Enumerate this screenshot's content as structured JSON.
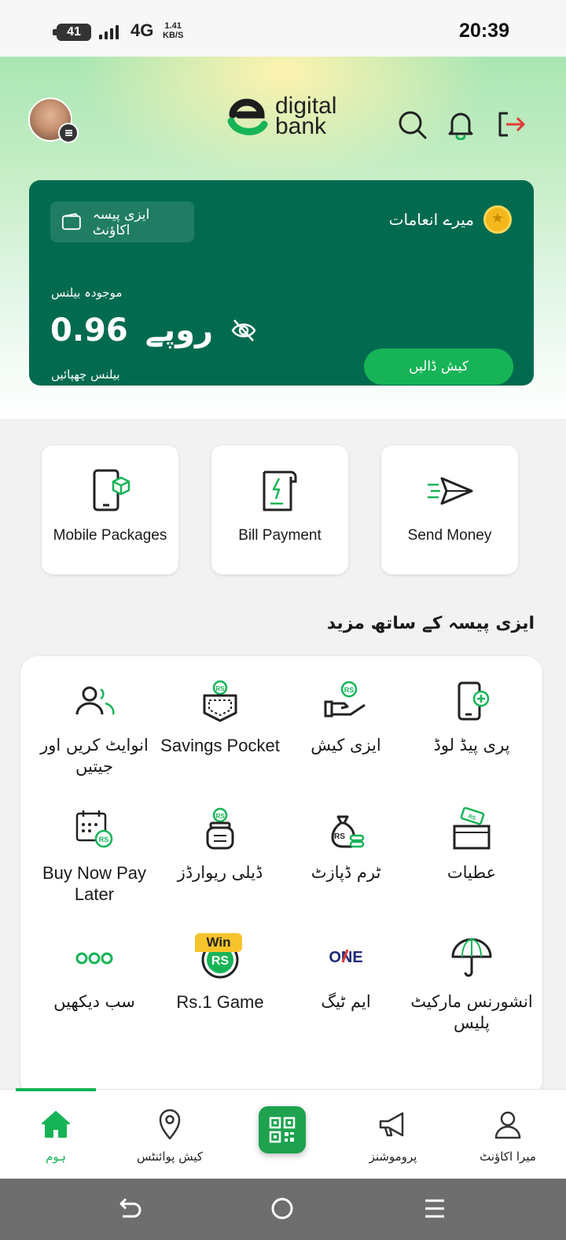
{
  "status_bar": {
    "battery": "41",
    "network": "4G",
    "speed_value": "1.41",
    "speed_unit": "KB/S",
    "time": "20:39"
  },
  "header": {
    "logo_line1": "digital",
    "logo_line2": "bank",
    "icons": [
      "search-icon",
      "bell-icon",
      "logout-icon"
    ]
  },
  "balance_card": {
    "wallet_label": "ایزی پیسہ اکاؤنٹ",
    "rewards_label": "میرے انعامات",
    "balance_label": "موجودہ بیلنس",
    "currency": "روپے",
    "amount": "0.96",
    "hide_label": "بیلنس چھپائیں",
    "cash_button": "کیش ڈالیں"
  },
  "quick_actions": [
    {
      "label": "Mobile Packages",
      "icon": "mobile-package-icon"
    },
    {
      "label": "Bill Payment",
      "icon": "bill-icon"
    },
    {
      "label": "Send Money",
      "icon": "send-icon"
    }
  ],
  "more_section": {
    "title": "ایزی پیسہ کے ساتھ مزید",
    "items": [
      {
        "label": "پری پیڈ لوڈ",
        "icon": "prepaid-load-icon"
      },
      {
        "label": "ایزی کیش",
        "icon": "easy-cash-icon"
      },
      {
        "label": "Savings Pocket",
        "icon": "savings-pocket-icon"
      },
      {
        "label": "انوایٹ کریں اور جیتیں",
        "icon": "invite-icon"
      },
      {
        "label": "عطیات",
        "icon": "donation-icon"
      },
      {
        "label": "ٹرم ڈپازٹ",
        "icon": "term-deposit-icon"
      },
      {
        "label": "ڈیلی ریوارڈز",
        "icon": "daily-rewards-icon"
      },
      {
        "label": "Buy Now Pay Later",
        "icon": "calendar-icon"
      },
      {
        "label": "انشورنس مارکیٹ پلیس",
        "icon": "umbrella-icon"
      },
      {
        "label": "ایم ٹیگ",
        "icon": "one-logo-icon"
      },
      {
        "label": "Rs.1 Game",
        "icon": "rs-coin-icon",
        "badge": "Win"
      },
      {
        "label": "سب دیکھیں",
        "icon": "more-dots-icon"
      }
    ]
  },
  "bottom_nav": {
    "items": [
      {
        "label": "میرا اکاؤنٹ",
        "icon": "user-icon"
      },
      {
        "label": "پروموشنز",
        "icon": "megaphone-icon"
      },
      {
        "label": "",
        "icon": "qr-icon"
      },
      {
        "label": "کیش پوائنٹس",
        "icon": "location-pin-icon"
      },
      {
        "label": "ہوم",
        "icon": "home-icon"
      }
    ]
  },
  "colors": {
    "primary_dark": "#026b4f",
    "accent": "#16b456"
  }
}
